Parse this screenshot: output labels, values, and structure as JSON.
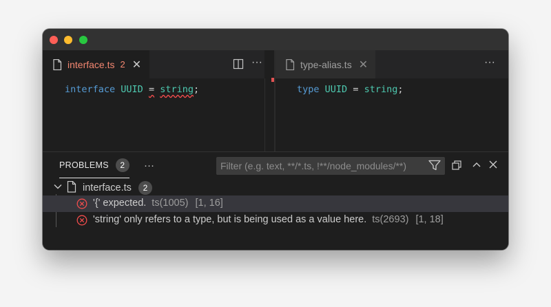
{
  "window": {
    "controls": [
      "close",
      "minimize",
      "maximize"
    ]
  },
  "editor_left": {
    "tab": {
      "filename": "interface.ts",
      "error_count": "2",
      "close_glyph": "✕"
    },
    "toolbar": {
      "split_icon": "split-editor-icon",
      "more_glyph": "···"
    },
    "code": {
      "keyword": "interface",
      "name": "UUID",
      "eq": "=",
      "value": "string",
      "semicolon": ";"
    }
  },
  "editor_right": {
    "tab": {
      "filename": "type-alias.ts",
      "close_glyph": "✕"
    },
    "toolbar": {
      "more_glyph": "···"
    },
    "code": {
      "keyword": "type",
      "name": "UUID",
      "eq": "=",
      "value": "string",
      "semicolon": ";"
    }
  },
  "panel": {
    "tab_label": "PROBLEMS",
    "tab_count": "2",
    "more_glyph": "···",
    "filter_placeholder": "Filter (e.g. text, **/*.ts, !**/node_modules/**)",
    "file_group": {
      "filename": "interface.ts",
      "count": "2"
    },
    "problems": [
      {
        "message": "'{' expected.",
        "source": "ts(1005)",
        "position": "[1, 16]"
      },
      {
        "message": "'string' only refers to a type, but is being used as a value here.",
        "source": "ts(2693)",
        "position": "[1, 18]"
      }
    ]
  },
  "colors": {
    "error": "#f14c4c",
    "keyword": "#569cd6",
    "type": "#4ec9b0",
    "background": "#1e1e1e"
  }
}
